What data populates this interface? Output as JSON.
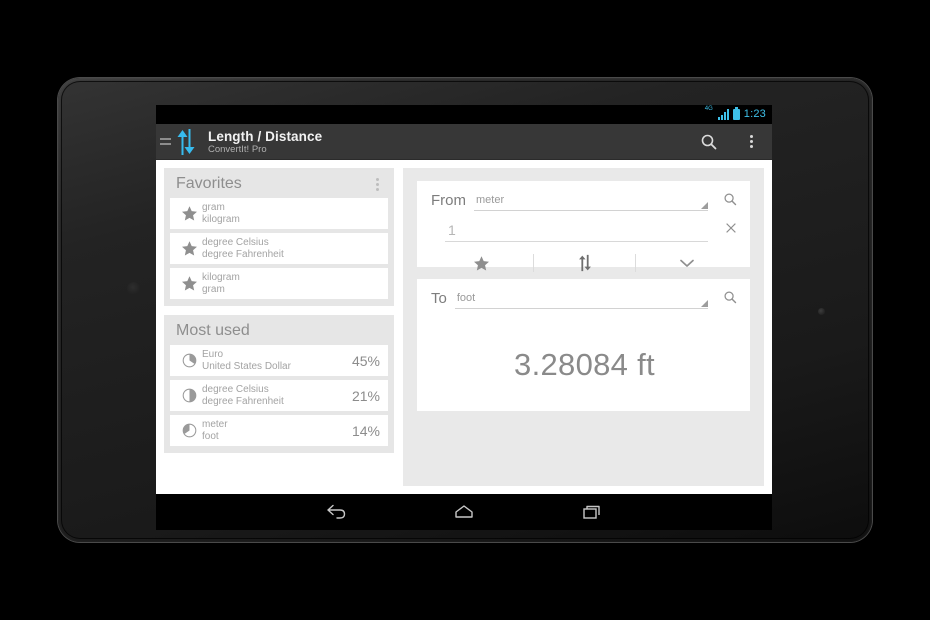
{
  "status_bar": {
    "network_label": "4G",
    "clock": "1:23",
    "signal_icon": "signal-bars-icon",
    "battery_icon": "battery-full-icon"
  },
  "action_bar": {
    "title": "Length / Distance",
    "subtitle": "ConvertIt! Pro",
    "logo_icon": "up-down-arrows-logo",
    "drawer_icon": "drawer-indicator-icon",
    "search_icon": "search-icon",
    "overflow_icon": "overflow-menu-icon",
    "accent_color": "#37bbee",
    "bar_color": "#373737"
  },
  "favorites": {
    "title": "Favorites",
    "menu_icon": "overflow-menu-icon",
    "items": [
      {
        "icon": "star-icon",
        "from": "gram",
        "to": "kilogram"
      },
      {
        "icon": "star-icon",
        "from": "degree Celsius",
        "to": "degree Fahrenheit"
      },
      {
        "icon": "star-icon",
        "from": "kilogram",
        "to": "gram"
      }
    ]
  },
  "most_used": {
    "title": "Most used",
    "items": [
      {
        "icon": "pie-chart-icon",
        "from": "Euro",
        "to": "United States Dollar",
        "percent": "45%"
      },
      {
        "icon": "pie-chart-icon",
        "from": "degree Celsius",
        "to": "degree Fahrenheit",
        "percent": "21%"
      },
      {
        "icon": "pie-chart-icon",
        "from": "meter",
        "to": "foot",
        "percent": "14%"
      }
    ]
  },
  "converter": {
    "from": {
      "label": "From",
      "unit": "meter",
      "value": "1",
      "search_icon": "search-icon",
      "clear_icon": "close-icon",
      "dropdown_icon": "spinner-triangle-icon"
    },
    "actions": {
      "favorite_icon": "star-icon",
      "swap_icon": "swap-vertical-icon",
      "expand_icon": "chevron-down-icon"
    },
    "to": {
      "label": "To",
      "unit": "foot",
      "search_icon": "search-icon",
      "dropdown_icon": "spinner-triangle-icon"
    },
    "result": "3.28084 ft"
  },
  "nav_bar": {
    "back_icon": "back-icon",
    "home_icon": "home-icon",
    "recents_icon": "recents-icon"
  }
}
